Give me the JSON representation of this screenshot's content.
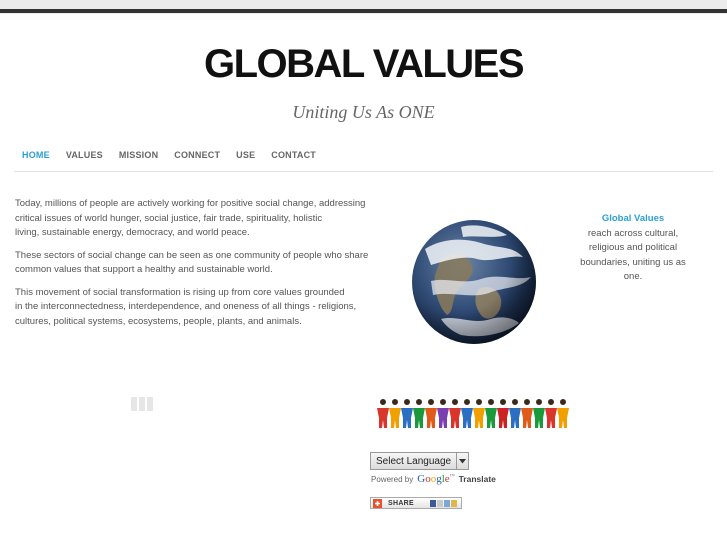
{
  "header": {
    "site_title": "GLOBAL VALUES",
    "tagline": "Uniting Us As ONE"
  },
  "nav": {
    "items": [
      {
        "label": "HOME",
        "active": true
      },
      {
        "label": "VALUES",
        "active": false
      },
      {
        "label": "MISSION",
        "active": false
      },
      {
        "label": "CONNECT",
        "active": false
      },
      {
        "label": "USE",
        "active": false
      },
      {
        "label": "CONTACT",
        "active": false
      }
    ]
  },
  "main": {
    "paragraphs": [
      [
        "Today, millions of people are actively working for positive social change, addressing",
        "critical issues of world hunger, social justice, fair trade, spirituality, holistic",
        "living, sustainable energy, democracy, and world peace."
      ],
      [
        "These sectors of social change can be seen as one community of people who share",
        "common values that support a healthy and sustainable world."
      ],
      [
        "This movement of social transformation is rising up from core values grounded",
        "in the interconnectedness, interdependence, and oneness of all things - religions,",
        "cultures, political systems, ecosystems, people, plants, and animals."
      ]
    ]
  },
  "sidebar": {
    "highlight": "Global Values",
    "lines": [
      "reach across cultural,",
      "religious and political",
      "boundaries, uniting us as",
      "one."
    ]
  },
  "translate": {
    "select_label": "Select Language",
    "powered_by": "Powered by",
    "google": [
      "G",
      "o",
      "o",
      "g",
      "l",
      "e"
    ],
    "tm": "™",
    "translate_label": "Translate"
  },
  "share": {
    "label": "SHARE"
  },
  "colors": {
    "accent": "#2aa0d6",
    "text": "#555555",
    "title": "#111111"
  },
  "icons": {
    "earth": "earth-globe-image",
    "people": "people-chain-image",
    "loading": "loading-bars-icon",
    "dropdown": "chevron-down-icon",
    "share": "share-plus-icon"
  }
}
